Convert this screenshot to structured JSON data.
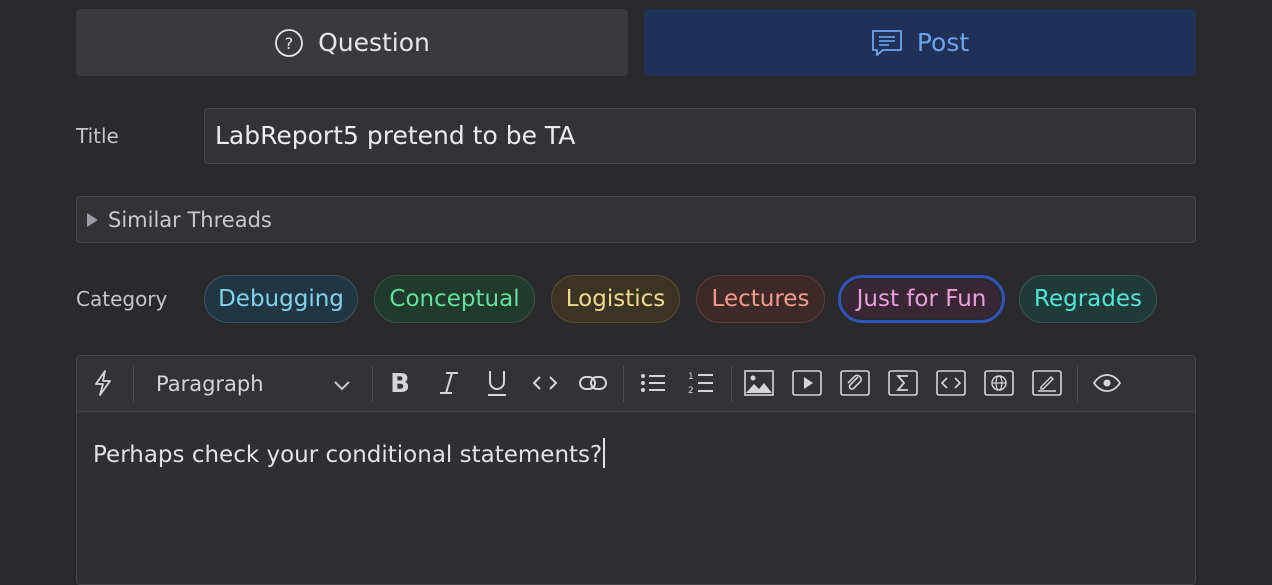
{
  "post_type": {
    "question_label": "Question",
    "post_label": "Post",
    "selected": "Post"
  },
  "title": {
    "label": "Title",
    "value": "LabReport5 pretend to be TA"
  },
  "similar_threads": {
    "label": "Similar Threads",
    "expanded": false
  },
  "category": {
    "label": "Category",
    "selected": "Just for Fun",
    "options": [
      {
        "label": "Debugging",
        "color": "#7fd4f2",
        "bg": "#223641",
        "border": "#35566a"
      },
      {
        "label": "Conceptual",
        "color": "#5fe39a",
        "bg": "#213a2d",
        "border": "#35573f"
      },
      {
        "label": "Logistics",
        "color": "#f2d98a",
        "bg": "#3b3424",
        "border": "#5a4f32"
      },
      {
        "label": "Lectures",
        "color": "#f39b89",
        "bg": "#3d2a28",
        "border": "#5e3d39"
      },
      {
        "label": "Just for Fun",
        "color": "#ec9de0",
        "bg": "#3a2734",
        "border": "#2f55b8"
      },
      {
        "label": "Regrades",
        "color": "#52e7dc",
        "bg": "#203a38",
        "border": "#315a56"
      }
    ]
  },
  "editor": {
    "block_format": "Paragraph",
    "toolbar_icons": [
      "lightning-icon",
      "bold-icon",
      "italic-icon",
      "underline-icon",
      "inline-code-icon",
      "link-icon",
      "bullet-list-icon",
      "numbered-list-icon",
      "image-icon",
      "video-icon",
      "attachment-icon",
      "math-icon",
      "code-block-icon",
      "web-embed-icon",
      "drawing-icon",
      "preview-eye-icon"
    ],
    "content": "Perhaps check your conditional statements?"
  }
}
